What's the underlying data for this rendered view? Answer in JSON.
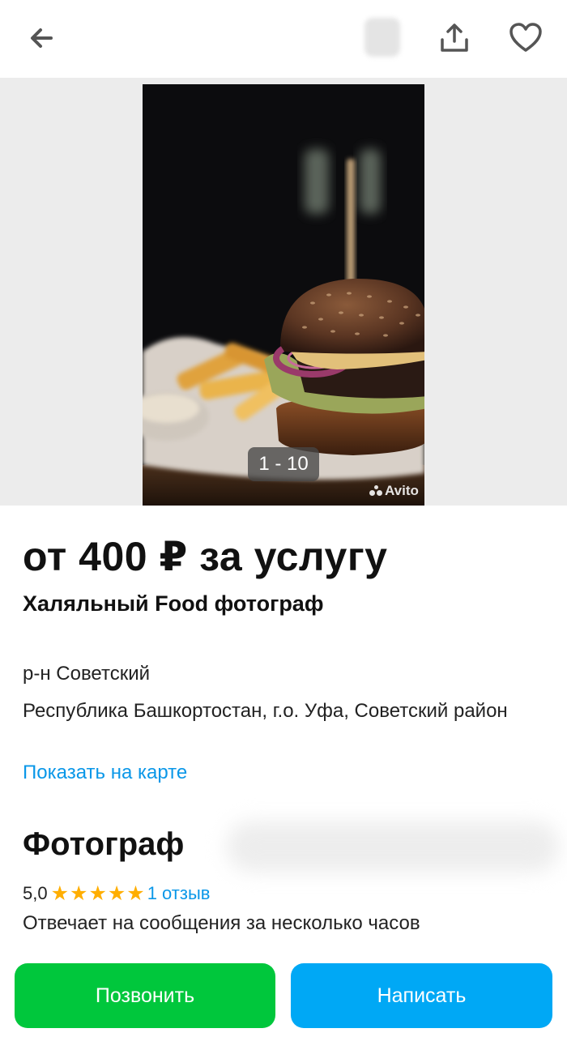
{
  "header": {
    "back_icon": "arrow-left-icon",
    "share_icon": "share-icon",
    "favorite_icon": "heart-icon"
  },
  "gallery": {
    "counter": "1 - 10",
    "watermark": "Avito"
  },
  "listing": {
    "price": "от 400 ₽ за услугу",
    "title": "Халяльный Food фотограф"
  },
  "location": {
    "district": "р-н Советский",
    "address": "Республика Башкортостан, г.о. Уфа, Советский район",
    "map_link": "Показать на карте"
  },
  "seller": {
    "name": "Фотограф",
    "rating": "5,0",
    "stars": 5,
    "reviews": "1 отзыв",
    "response_time": "Отвечает на сообщения за несколько часов"
  },
  "actions": {
    "call_label": "Позвонить",
    "write_label": "Написать"
  },
  "colors": {
    "accent_blue": "#00a8f5",
    "link_blue": "#0a97e8",
    "call_green": "#00c73c",
    "star": "#ffae00"
  }
}
